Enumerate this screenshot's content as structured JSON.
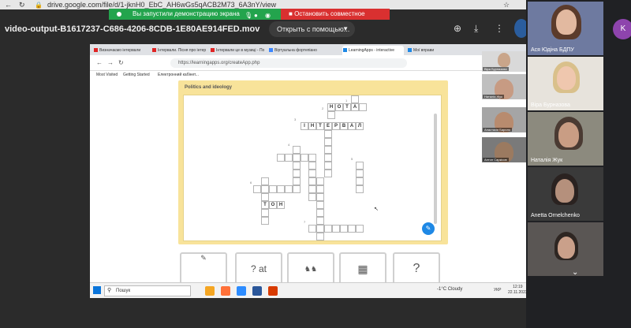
{
  "browser": {
    "url": "drive.google.com/file/d/1-jknH0_EbC_AH6wGs5qACB2M73_6A3nY/view"
  },
  "share_banner": {
    "status": "Вы запустили демонстрацию экрана",
    "stop": "Остановить совместное использование"
  },
  "drive": {
    "filename": "video-output-B1617237-C686-4206-8CDB-1E80AE914FED.mov",
    "open_with": "Открыть с помощью...",
    "badge_letter": "K"
  },
  "inner_browser": {
    "tabs": [
      "Визначаємо інтервали",
      "Інтервали. Пісня про інтер",
      "Інтервали це в музиці - По",
      "Віртуальна фортепіано",
      "LearningApps - interactive",
      "Мої вправи"
    ],
    "address": "https://learningapps.org/createApp.php",
    "bookmarks": [
      "Most Visited",
      "Getting Started",
      "Електронний кабінет..."
    ]
  },
  "learningapps": {
    "title": "Politics and ideology",
    "words": {
      "nota": [
        "Н",
        "О",
        "Т",
        "А"
      ],
      "interval": [
        "І",
        "Н",
        "Т",
        "Е",
        "Р",
        "В",
        "А",
        "Л"
      ],
      "ton": [
        "Т",
        "О",
        "Н"
      ]
    },
    "numbers": [
      "1",
      "2",
      "3",
      "4",
      "5",
      "6",
      "7"
    ]
  },
  "thumb_labels": [
    "?",
    "at"
  ],
  "taskbar": {
    "search_placeholder": "Пошук",
    "weather": "-1°C Cloudy",
    "lang": "УКР",
    "time": "12:19",
    "date": "22.11.2023"
  },
  "mini_participants": [
    "Віра Бурназова",
    "Наталія Жук",
    "Анастасія Барило",
    "Антон Саркісов"
  ],
  "participants": [
    {
      "name": "Ася Юдіна БДПУ"
    },
    {
      "name": "Віра Бурназова"
    },
    {
      "name": "Наталія Жук"
    },
    {
      "name": "Anetta Ornelchenko"
    },
    {
      "name": ""
    }
  ],
  "colors": {
    "green_banner": "#23a44d",
    "red_banner": "#d93030",
    "panel_yellow": "#f8e39a",
    "accent_blue": "#1e88e5"
  }
}
